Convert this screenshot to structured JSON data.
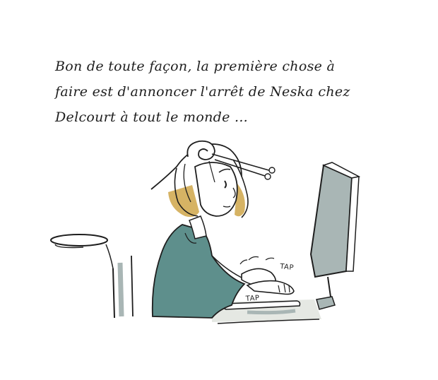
{
  "caption": {
    "lines": [
      "Bon de toute façon, la première chose à",
      "faire est d'annoncer l'arrêt de Neska chez",
      "Delcourt à tout le monde ..."
    ]
  },
  "sound_effects": {
    "tap_upper": "TAP",
    "tap_lower": "TAP"
  },
  "colors": {
    "sweater": "#5e8f8c",
    "hair": "#d6b364",
    "monitor": "#a9b6b5",
    "table": "#e5e8e3",
    "ink": "#1e1e1e"
  }
}
